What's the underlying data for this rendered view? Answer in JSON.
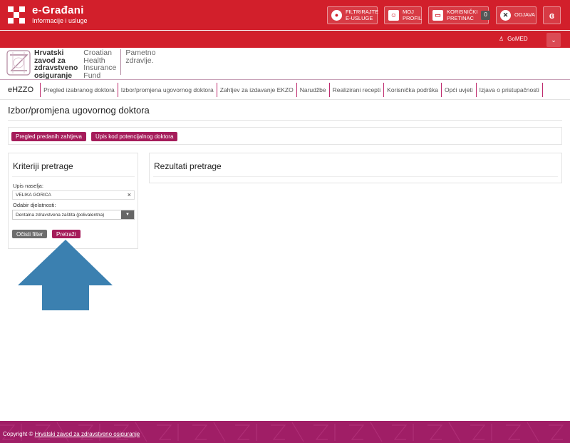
{
  "header": {
    "brand_title": "e-Građani",
    "brand_subtitle": "Informacije i usluge",
    "filter_button": "FILTRIRAJTE\nE-USLUGE",
    "profile_button": "MOJ\nPROFIL",
    "inbox_button": "KORISNIČKI\nPRETINAC",
    "inbox_count": "0",
    "logout_button": "ODJAVA",
    "lang_button": "ɞ",
    "user_name": "GoMED"
  },
  "hzzo": {
    "name_hr": "Hrvatski\nzavod za\nzdravstveno\nosiguranje",
    "name_en": "Croatian\nHealth\nInsurance\nFund",
    "slogan": "Pametno\nzdravlje."
  },
  "nav": {
    "home": "eHZZO",
    "items": [
      "Pregled izabranog doktora",
      "Izbor/promjena ugovornog doktora",
      "Zahtjev za izdavanje EKZO",
      "Narudžbe",
      "Realizirani recepti",
      "Korisnička podrška",
      "Opći uvjeti",
      "Izjava o pristupačnosti"
    ]
  },
  "page": {
    "title": "Izbor/promjena ugovornog doktora",
    "tab_submitted": "Pregled predanih zahtjeva",
    "tab_enroll": "Upis kod potencijalnog doktora"
  },
  "criteria": {
    "title": "Kriteriji pretrage",
    "settlement_label": "Upis naselja:",
    "settlement_value": "VELIKA GORICA",
    "activity_label": "Odabir djelatnosti:",
    "activity_value": "Dentalna zdravstvena zaštita (polivalentna)",
    "clear_button": "Očisti filter",
    "search_button": "Pretraži"
  },
  "results": {
    "title": "Rezultati pretrage"
  },
  "footer": {
    "copyright": "Copyright ©",
    "link": "Hrvatski zavod za zdravstveno osiguranje"
  },
  "colors": {
    "header_red": "#d21f2b",
    "accent_magenta": "#a51c5a",
    "arrow_blue": "#3b80b0"
  }
}
